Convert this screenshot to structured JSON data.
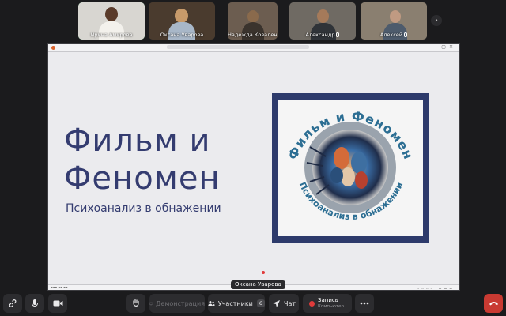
{
  "participants": [
    {
      "name": "Ирина Амирова",
      "active": true,
      "muted": false
    },
    {
      "name": "Оксана Уварова",
      "active": false,
      "muted": false
    },
    {
      "name": "Надежда Коваленко",
      "active": false,
      "muted": false
    },
    {
      "name": "Александр",
      "active": false,
      "muted": true
    },
    {
      "name": "Алексей",
      "active": false,
      "muted": true
    }
  ],
  "strip_next_glyph": "›",
  "slide": {
    "title_line1": "Фильм и",
    "title_line2": "Феномен",
    "subtitle": "Психоанализ в обнажении",
    "logo_text_top": "Фильм и Феномен",
    "logo_text_bottom": "Психоанализ в обнажении"
  },
  "speaker_label": "Оксана Уварова",
  "toolbar": {
    "share_label": "Демонстрация",
    "participants_label": "Участники",
    "participants_count": "6",
    "chat_label": "Чат",
    "record_label": "Запись",
    "record_sub": "Компьютер"
  },
  "colors": {
    "accent_green": "#3fb36a",
    "slide_text": "#343c70",
    "logo_frame": "#2d3a6b",
    "record_red": "#e03b3b",
    "leave_red": "#c93a32"
  }
}
